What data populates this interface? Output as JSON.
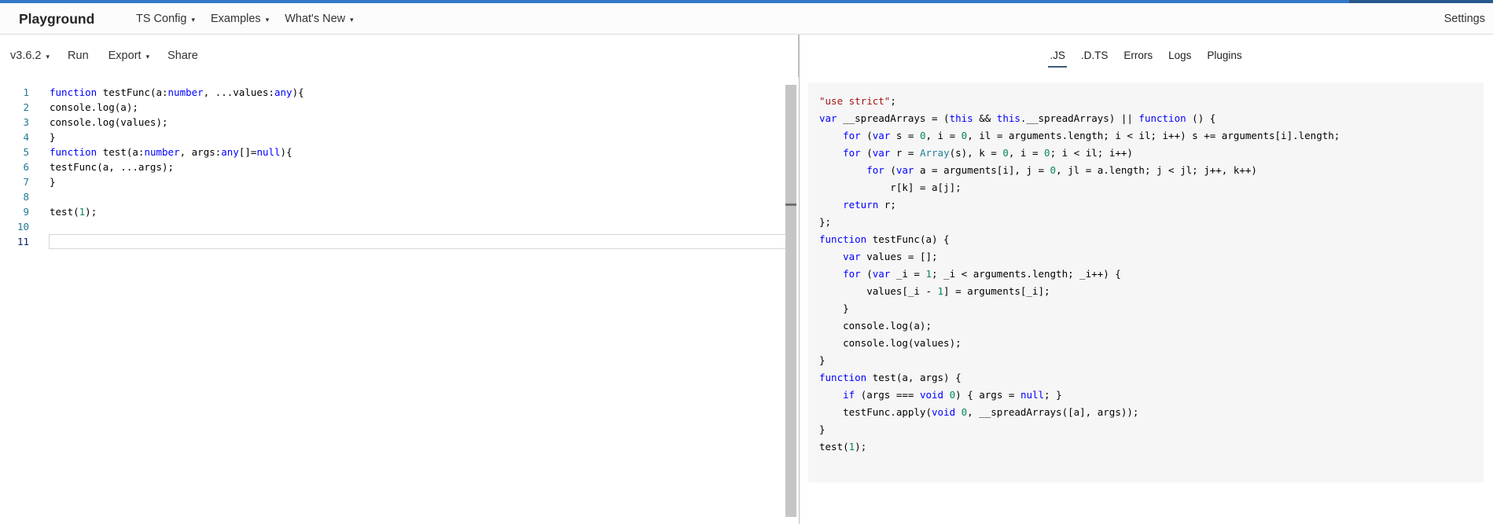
{
  "header": {
    "brand": "Playground",
    "nav": [
      {
        "label": "TS Config"
      },
      {
        "label": "Examples"
      },
      {
        "label": "What's New"
      }
    ],
    "settings_label": "Settings"
  },
  "toolbar": {
    "version_label": "v3.6.2",
    "run_label": "Run",
    "export_label": "Export",
    "share_label": "Share"
  },
  "icons": {
    "caret_glyph": "▾",
    "dock_icon_name": "dock-to-right-icon"
  },
  "tabs": [
    {
      "label": ".JS",
      "active": true
    },
    {
      "label": ".D.TS",
      "active": false
    },
    {
      "label": "Errors",
      "active": false
    },
    {
      "label": "Logs",
      "active": false
    },
    {
      "label": "Plugins",
      "active": false
    }
  ],
  "editor": {
    "active_line": 11,
    "lines": [
      [
        [
          "k",
          "function"
        ],
        [
          "p",
          " testFunc(a:"
        ],
        [
          "k",
          "number"
        ],
        [
          "p",
          ", ...values:"
        ],
        [
          "k",
          "any"
        ],
        [
          "p",
          "){"
        ]
      ],
      [
        [
          "p",
          "console.log(a);"
        ]
      ],
      [
        [
          "p",
          "console.log(values);"
        ]
      ],
      [
        [
          "p",
          "}"
        ]
      ],
      [
        [
          "k",
          "function"
        ],
        [
          "p",
          " test(a:"
        ],
        [
          "k",
          "number"
        ],
        [
          "p",
          ", args:"
        ],
        [
          "k",
          "any"
        ],
        [
          "p",
          "[]="
        ],
        [
          "k",
          "null"
        ],
        [
          "p",
          "){"
        ]
      ],
      [
        [
          "p",
          "testFunc(a, ...args);"
        ]
      ],
      [
        [
          "p",
          "}"
        ]
      ],
      [],
      [
        [
          "p",
          "test("
        ],
        [
          "n",
          "1"
        ],
        [
          "p",
          ");"
        ]
      ],
      [],
      []
    ]
  },
  "output": {
    "lines": [
      [
        [
          "s",
          "\"use strict\""
        ],
        [
          "p",
          ";"
        ]
      ],
      [
        [
          "k",
          "var"
        ],
        [
          "p",
          " __spreadArrays = ("
        ],
        [
          "k",
          "this"
        ],
        [
          "p",
          " && "
        ],
        [
          "k",
          "this"
        ],
        [
          "p",
          ".__spreadArrays) || "
        ],
        [
          "k",
          "function"
        ],
        [
          "p",
          " () {"
        ]
      ],
      [
        [
          "p",
          "    "
        ],
        [
          "k",
          "for"
        ],
        [
          "p",
          " ("
        ],
        [
          "k",
          "var"
        ],
        [
          "p",
          " s = "
        ],
        [
          "n",
          "0"
        ],
        [
          "p",
          ", i = "
        ],
        [
          "n",
          "0"
        ],
        [
          "p",
          ", il = arguments.length; i < il; i++) s += arguments[i].length;"
        ]
      ],
      [
        [
          "p",
          "    "
        ],
        [
          "k",
          "for"
        ],
        [
          "p",
          " ("
        ],
        [
          "k",
          "var"
        ],
        [
          "p",
          " r = "
        ],
        [
          "t",
          "Array"
        ],
        [
          "p",
          "(s), k = "
        ],
        [
          "n",
          "0"
        ],
        [
          "p",
          ", i = "
        ],
        [
          "n",
          "0"
        ],
        [
          "p",
          "; i < il; i++)"
        ]
      ],
      [
        [
          "p",
          "        "
        ],
        [
          "k",
          "for"
        ],
        [
          "p",
          " ("
        ],
        [
          "k",
          "var"
        ],
        [
          "p",
          " a = arguments[i], j = "
        ],
        [
          "n",
          "0"
        ],
        [
          "p",
          ", jl = a.length; j < jl; j++, k++)"
        ]
      ],
      [
        [
          "p",
          "            r[k] = a[j];"
        ]
      ],
      [
        [
          "p",
          "    "
        ],
        [
          "k",
          "return"
        ],
        [
          "p",
          " r;"
        ]
      ],
      [
        [
          "p",
          "};"
        ]
      ],
      [
        [
          "k",
          "function"
        ],
        [
          "p",
          " testFunc(a) {"
        ]
      ],
      [
        [
          "p",
          "    "
        ],
        [
          "k",
          "var"
        ],
        [
          "p",
          " values = [];"
        ]
      ],
      [
        [
          "p",
          "    "
        ],
        [
          "k",
          "for"
        ],
        [
          "p",
          " ("
        ],
        [
          "k",
          "var"
        ],
        [
          "p",
          " _i = "
        ],
        [
          "n",
          "1"
        ],
        [
          "p",
          "; _i < arguments.length; _i++) {"
        ]
      ],
      [
        [
          "p",
          "        values[_i - "
        ],
        [
          "n",
          "1"
        ],
        [
          "p",
          "] = arguments[_i];"
        ]
      ],
      [
        [
          "p",
          "    }"
        ]
      ],
      [
        [
          "p",
          "    console.log(a);"
        ]
      ],
      [
        [
          "p",
          "    console.log(values);"
        ]
      ],
      [
        [
          "p",
          "}"
        ]
      ],
      [
        [
          "k",
          "function"
        ],
        [
          "p",
          " test(a, args) {"
        ]
      ],
      [
        [
          "p",
          "    "
        ],
        [
          "k",
          "if"
        ],
        [
          "p",
          " (args === "
        ],
        [
          "k",
          "void"
        ],
        [
          "p",
          " "
        ],
        [
          "n",
          "0"
        ],
        [
          "p",
          ") { args = "
        ],
        [
          "k",
          "null"
        ],
        [
          "p",
          "; }"
        ]
      ],
      [
        [
          "p",
          "    testFunc.apply("
        ],
        [
          "k",
          "void"
        ],
        [
          "p",
          " "
        ],
        [
          "n",
          "0"
        ],
        [
          "p",
          ", __spreadArrays([a], args));"
        ]
      ],
      [
        [
          "p",
          "}"
        ]
      ],
      [
        [
          "p",
          "test("
        ],
        [
          "n",
          "1"
        ],
        [
          "p",
          ");"
        ]
      ]
    ]
  },
  "colors": {
    "accent_left": "#3178c6",
    "accent_right": "#28598c",
    "tok_keyword": "#0000ff",
    "tok_number": "#098658",
    "tok_string": "#a31515",
    "tok_type": "#267f99",
    "tok_plain": "#000000",
    "line_number": "#237893",
    "line_number_active": "#0b216f",
    "tab_underline": "#415a77"
  }
}
